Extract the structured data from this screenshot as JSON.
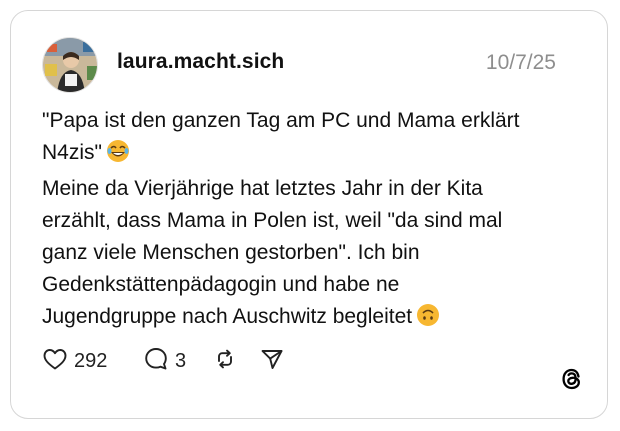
{
  "post": {
    "username": "laura.macht.sich",
    "date": "10/7/25",
    "text_lines": [
      "\"Papa ist den ganzen Tag am PC und Mama erklärt",
      "N4zis\"",
      "Meine da Vierjährige hat letztes Jahr in der Kita",
      "erzählt, dass Mama in Polen ist, weil \"da sind mal",
      "ganz viele Menschen gestorben\". Ich bin",
      "Gedenkstättenpädagogin und habe ne",
      "Jugendgruppe nach Auschwitz begleitet"
    ],
    "emojis": {
      "line2": "face-with-tears-of-joy",
      "line7": "upside-down-face"
    }
  },
  "actions": {
    "like_icon": "heart-icon",
    "like_count": "292",
    "comment_icon": "comment-icon",
    "comment_count": "3",
    "repost_icon": "repost-icon",
    "share_icon": "share-icon"
  },
  "brand": {
    "logo_icon": "threads-logo-icon"
  },
  "colors": {
    "text": "#111111",
    "muted": "#8e8e8e",
    "border": "#d6d6d6",
    "emoji_yellow": "#f7b731"
  }
}
